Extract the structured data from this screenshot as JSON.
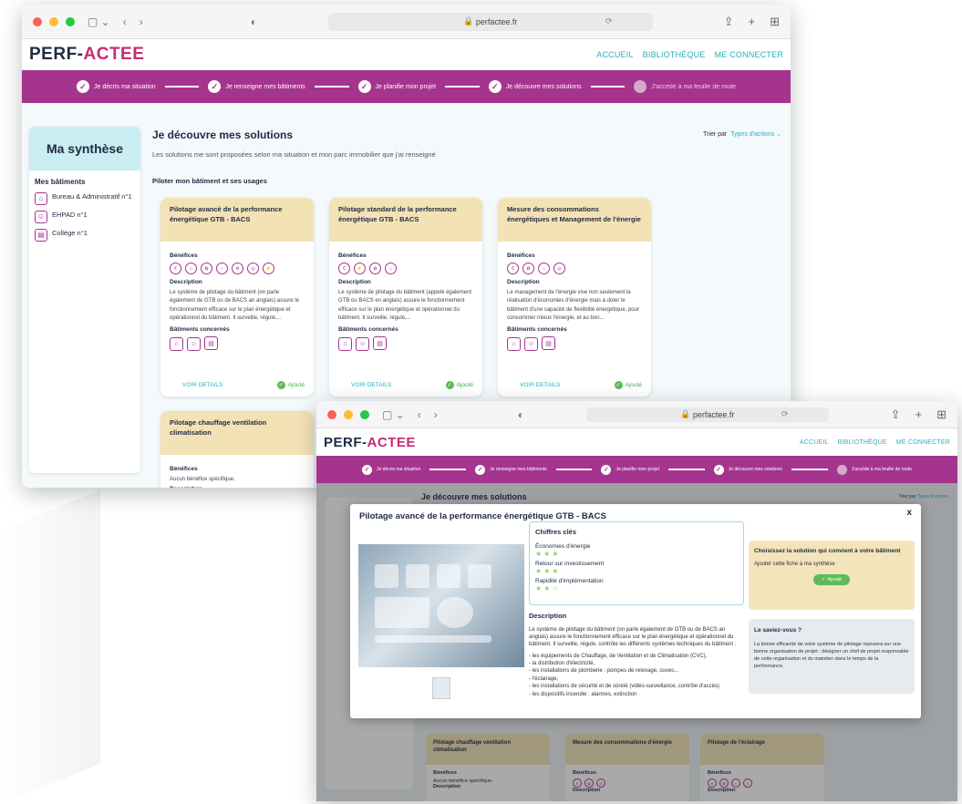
{
  "browser": {
    "url": "perfactee.fr"
  },
  "brand": {
    "logo_prefix": "PERF-",
    "logo_accent": "ACTEE"
  },
  "nav": [
    "ACCUEIL",
    "BIBLIOTHÈQUE",
    "ME CONNECTER"
  ],
  "steps": [
    "Je décris ma situation",
    "Je renseigne mes bâtiments",
    "Je planifie mon projet",
    "Je découvre mes solutions",
    "J'accède à ma feuille de route"
  ],
  "sidebar": {
    "title": "Ma synthèse",
    "section": "Mes bâtiments",
    "buildings": [
      "Bureau & Administratif n°1",
      "EHPAD n°1",
      "Collège n°1"
    ]
  },
  "main": {
    "title": "Je découvre mes solutions",
    "subtitle": "Les solutions me sont proposées selon ma situation et mon parc immobilier que j'ai renseigné",
    "sort_label": "Trier par",
    "sort_value": "Types d'actions",
    "group": "Piloter mon bâtiment et ses usages"
  },
  "labels": {
    "benefits": "Bénéfices",
    "description": "Description",
    "buildings": "Bâtiments concernés",
    "details": "VOIR DETAILS",
    "added": "Ajouté"
  },
  "cards": [
    {
      "title": "Pilotage avancé de la performance énergétique GTB - BACS",
      "desc": "Le système de pilotage du bâtiment (on parle également de GTB ou de BACS an anglais) assure le fonctionnement efficace sur le plan énergétique et opérationnel du bâtiment. Il surveille, régule,..."
    },
    {
      "title": "Pilotage standard de la performance énergétique GTB - BACS",
      "desc": "Le système de pilotage du bâtiment (appelé également GTB ou BACS en anglais) assure le fonctionnement efficace sur le plan énergétique et opérationnel du bâtiment. Il surveille, régule,..."
    },
    {
      "title": "Mesure des consommations énergétiques et Management de l'énergie",
      "desc": "Le management de l'énergie vise non seulement la réalisation d'économies d'énergie mais à doter le bâtiment d'une capacité de flexibilité énergétique, pour consommer mieux l'énergie, et au bon..."
    },
    {
      "title": "Pilotage chauffage ventilation climatisation",
      "desc": "Aucun bénéfice spécifique."
    }
  ],
  "modal": {
    "title": "Pilotage avancé de la performance énergétique GTB - BACS",
    "close": "x",
    "key_title": "Chiffres clés",
    "key_items": [
      {
        "label": "Économies d'énergie",
        "stars": "★★★"
      },
      {
        "label": "Retour sur investissement",
        "stars": "★★★"
      },
      {
        "label": "Rapidité d'implémentation",
        "stars": "★★☆"
      }
    ],
    "desc_title": "Description",
    "desc_text": "Le système de pilotage du bâtiment (on parle également de GTB ou de BACS an anglais) assure le fonctionnement efficace sur le plan énergétique et opérationnel du bâtiment. Il surveille, régule, contrôle les différents systèmes techniques du bâtiment :",
    "desc_list": [
      "- les équipements de Chauffage, de Ventilation et de Climatisation (CVC),",
      "- la distribution d'électricité,",
      "- les installations de plomberie : pompes de relevage, cuves...",
      "- l'éclairage,",
      "- les installations de sécurité et de sûreté (vidéo-surveillance, contrôle d'accès)",
      "- les dispositifs incendie : alarmes, extinction"
    ],
    "choice_title": "Choisissez la solution qui convient à votre bâtiment",
    "choice_text": "Ajouter cette fiche à ma synthèse",
    "added": "Ajouté",
    "tip_title": "Le saviez-vous ?",
    "tip_text": "La bonne efficacité de votre système de pilotage reposera sur une bonne organisation de projet : désigner un chef de projet responsable de cette organisation et du maintien dans le temps de la performance."
  },
  "back_cards": [
    "Pilotage chauffage ventilation climatisation",
    "Mesure des consommations d'énergie",
    "Pilotage de l'éclairage"
  ],
  "back_labels": {
    "benefits": "Bénéfices",
    "none": "Aucun bénéfice spécifique.",
    "description": "Description"
  }
}
